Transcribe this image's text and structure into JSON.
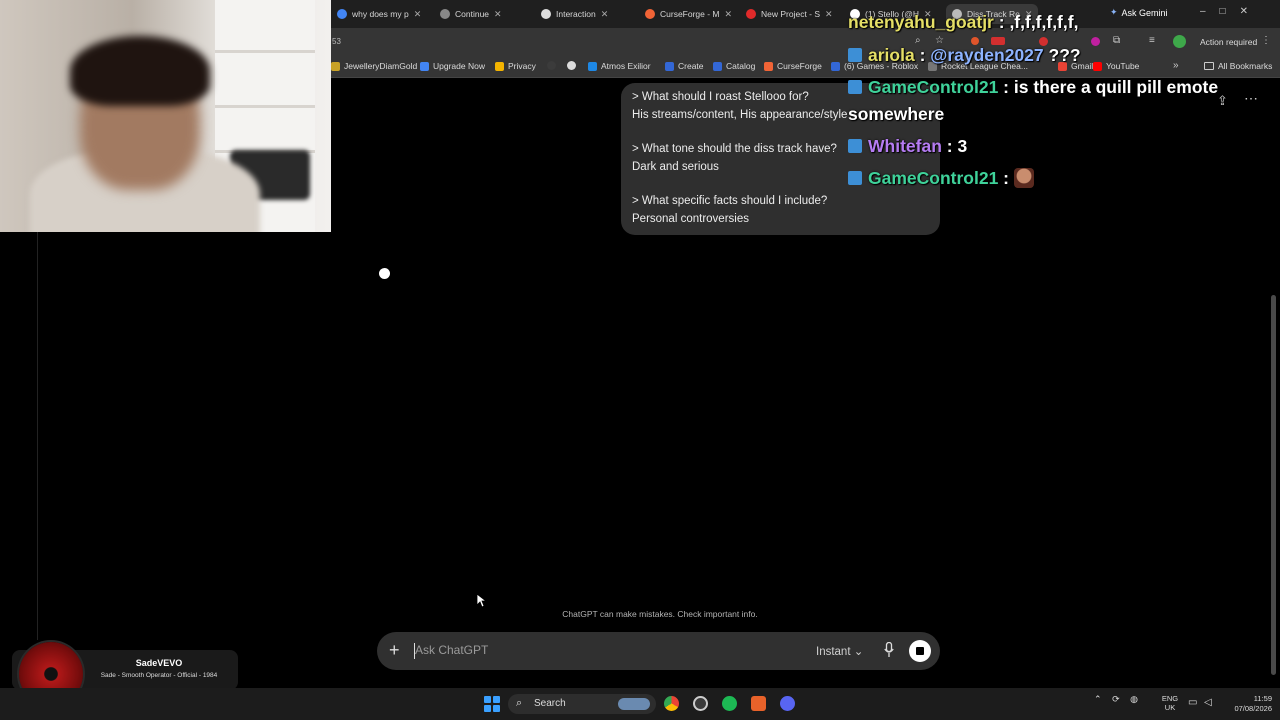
{
  "browser": {
    "tabs": [
      {
        "label": "why does my p",
        "color": "#4285f4"
      },
      {
        "label": "Continue",
        "color": "#888888"
      },
      {
        "label": "Interaction",
        "color": "#dddddd"
      },
      {
        "label": "CurseForge - M",
        "color": "#f16436"
      },
      {
        "label": "New Project - S",
        "color": "#e02a2a"
      },
      {
        "label": "(1) Stello (@H",
        "color": "#ffffff"
      },
      {
        "label": "Diss Track Re",
        "color": "#bbbbbb"
      }
    ],
    "ask_gemini": "Ask Gemini",
    "address_fragment": "53",
    "action_required": "Action required",
    "bookmarks": [
      "JewelleryDiamGold",
      "Upgrade Now",
      "Privacy",
      "Atmos Exilior",
      "Create",
      "Catalog",
      "CurseForge",
      "(6) Games - Roblox",
      "Rocket League Chea...",
      "Gmail",
      "YouTube"
    ],
    "all_bookmarks": "All Bookmarks"
  },
  "conversation": {
    "items": [
      {
        "q": "> What should I roast Stellooo for?",
        "a": "His streams/content, His appearance/style"
      },
      {
        "q": "> What tone should the diss track have?",
        "a": "Dark and serious"
      },
      {
        "q": "> What specific facts should I include?",
        "a": "Personal controversies"
      }
    ],
    "disclaimer": "ChatGPT can make mistakes. Check important info."
  },
  "composer": {
    "placeholder": "Ask ChatGPT",
    "mode": "Instant",
    "plus": "+",
    "chevron": "⌄"
  },
  "chat_overlay": [
    {
      "user": "netenyahu_goatjr",
      "sep": " : ",
      "text": ",f,f,f,f,f,f,",
      "color": "#e5df66"
    },
    {
      "user": "ariola",
      "sep": " : ",
      "mention": "@rayden2027",
      "text": " ???",
      "color": "#e5df66"
    },
    {
      "user": "GameControl21",
      "sep": " : ",
      "text": "is there a quill pill emote",
      "color": "#3fd29a"
    },
    {
      "continuation": "somewhere"
    },
    {
      "user": "Whitefan",
      "sep": " : ",
      "text": "3",
      "color": "#b57cf2"
    },
    {
      "user": "GameControl21",
      "sep": " : ",
      "text": "",
      "color": "#3fd29a",
      "emote": "face-emote"
    }
  ],
  "music": {
    "artist": "SadeVEVO",
    "title": "Sade - Smooth Operator - Official - 1984"
  },
  "taskbar": {
    "search": "Search",
    "lang_top": "ENG",
    "lang_bottom": "UK",
    "time": "11:59",
    "date": "07/08/2026"
  }
}
